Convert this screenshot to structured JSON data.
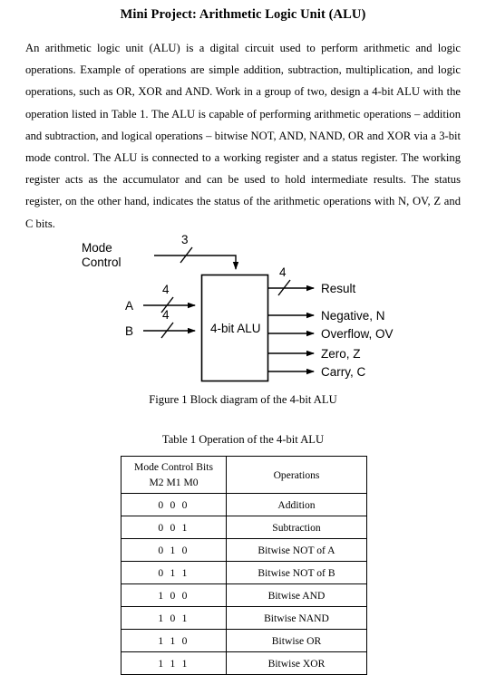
{
  "document": {
    "title": "Mini Project: Arithmetic Logic Unit (ALU)",
    "paragraph": "An arithmetic logic unit (ALU) is a digital circuit used to perform arithmetic and logic operations. Example of operations are simple addition, subtraction, multiplication, and logic operations, such as OR, XOR and AND. Work in a group of two, design a 4-bit ALU with the operation listed in Table 1. The ALU is capable of performing arithmetic operations – addition and subtraction, and logical operations – bitwise NOT, AND, NAND, OR and XOR via a 3-bit mode control. The ALU is connected to a working register and a status register. The working register acts as the accumulator and can be used to hold intermediate results. The status register, on the other hand, indicates the status of the arithmetic operations with N, OV, Z and C bits."
  },
  "figure": {
    "caption": "Figure 1 Block diagram of the 4-bit ALU",
    "block_label": "4-bit ALU",
    "mode_control_label_line1": "Mode",
    "mode_control_label_line2": "Control",
    "mode_bus_width": "3",
    "input_a_label": "A",
    "input_a_bus_width": "4",
    "input_b_label": "B",
    "input_b_bus_width": "4",
    "result_bus_width": "4",
    "outputs": [
      "Result",
      "Negative, N",
      "Overflow, OV",
      "Zero, Z",
      "Carry, C"
    ]
  },
  "table": {
    "caption": "Table 1 Operation of the 4-bit ALU",
    "headers": {
      "mode_line1": "Mode Control Bits",
      "mode_line2": "M2 M1 M0",
      "operations": "Operations"
    },
    "rows": [
      {
        "mode": "0 0 0",
        "operation": "Addition"
      },
      {
        "mode": "0 0 1",
        "operation": "Subtraction"
      },
      {
        "mode": "0 1 0",
        "operation": "Bitwise NOT of A"
      },
      {
        "mode": "0 1 1",
        "operation": "Bitwise NOT of B"
      },
      {
        "mode": "1 0 0",
        "operation": "Bitwise AND"
      },
      {
        "mode": "1 0 1",
        "operation": "Bitwise NAND"
      },
      {
        "mode": "1 1 0",
        "operation": "Bitwise OR"
      },
      {
        "mode": "1 1 1",
        "operation": "Bitwise XOR"
      }
    ]
  },
  "colors": {
    "text": "#000000",
    "background": "#ffffff",
    "line": "#000000"
  }
}
